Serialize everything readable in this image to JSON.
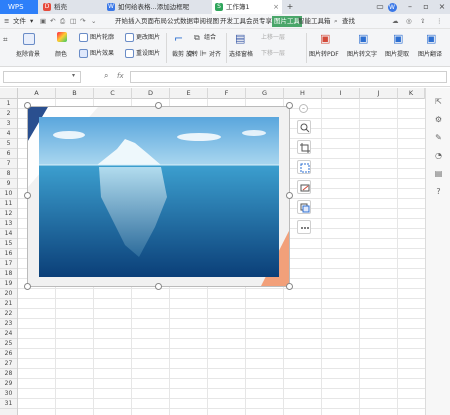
{
  "titlebar": {
    "app_button": "WPS",
    "tabs": [
      {
        "label": "稻壳",
        "icon_color": "#e64a3b"
      },
      {
        "label": "如何给表格...添加边框呢",
        "icon_color": "#3b78e7"
      },
      {
        "label": "工作簿1",
        "icon_color": "#2fa55b"
      }
    ],
    "user_badge": "W"
  },
  "menubar": {
    "file": "文件",
    "items": [
      "开始",
      "插入",
      "页面布局",
      "公式",
      "数据",
      "审阅",
      "视图",
      "开发工具",
      "会员专享",
      "图片工具",
      "智能工具箱"
    ],
    "active_item": "图片工具",
    "search": "查找"
  },
  "ribbon": {
    "remove_bg": "抠除背景",
    "color": "颜色",
    "outline": "图片轮廓",
    "effects": "图片效果",
    "change_pic": "更改图片",
    "reset_pic": "重设图片",
    "crop": "裁剪",
    "group": "组合",
    "rotate": "旋转",
    "align": "对齐",
    "selection_pane": "选择窗格",
    "up_one": "上移一层",
    "down_one": "下移一层",
    "pic_to_pdf": "图片转PDF",
    "pic_to_text": "图片转文字",
    "pic_extract": "图片提取",
    "pic_translate": "图片翻译"
  },
  "formulabar": {
    "fx": "fx"
  },
  "sheet": {
    "columns": [
      "A",
      "B",
      "C",
      "D",
      "E",
      "F",
      "G",
      "H",
      "I",
      "J",
      "K"
    ],
    "rows": [
      "1",
      "2",
      "3",
      "4",
      "5",
      "6",
      "7",
      "8",
      "9",
      "10",
      "11",
      "12",
      "13",
      "14",
      "15",
      "16",
      "17",
      "18",
      "19",
      "20",
      "21",
      "22",
      "23",
      "24",
      "25",
      "26",
      "27",
      "28",
      "29",
      "30",
      "31"
    ]
  },
  "float_tools": [
    "collapse-icon",
    "zoom-icon",
    "crop-icon",
    "select-icon",
    "edit-icon",
    "convert-icon",
    "more-icon"
  ]
}
